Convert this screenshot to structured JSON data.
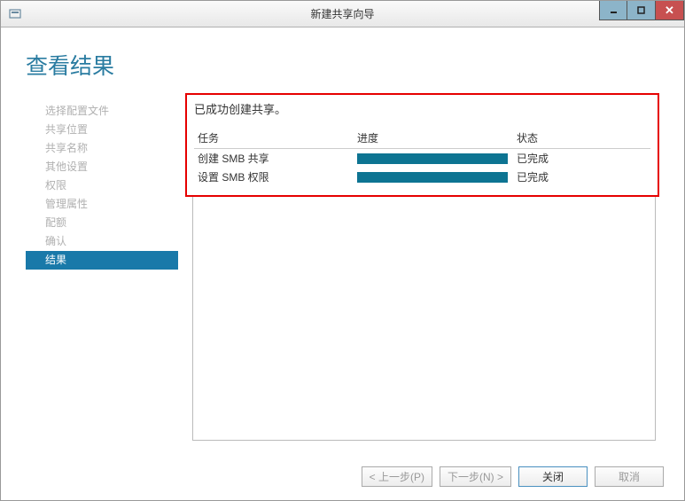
{
  "window": {
    "title": "新建共享向导"
  },
  "heading": "查看结果",
  "sidebar": {
    "items": [
      {
        "label": "选择配置文件",
        "active": false
      },
      {
        "label": "共享位置",
        "active": false
      },
      {
        "label": "共享名称",
        "active": false
      },
      {
        "label": "其他设置",
        "active": false
      },
      {
        "label": "权限",
        "active": false
      },
      {
        "label": "管理属性",
        "active": false
      },
      {
        "label": "配额",
        "active": false
      },
      {
        "label": "确认",
        "active": false
      },
      {
        "label": "结果",
        "active": true
      }
    ]
  },
  "main": {
    "result_message": "已成功创建共享。",
    "columns": {
      "task": "任务",
      "progress": "进度",
      "status": "状态"
    },
    "tasks": [
      {
        "name": "创建 SMB 共享",
        "progress": 100,
        "status": "已完成"
      },
      {
        "name": "设置 SMB 权限",
        "progress": 100,
        "status": "已完成"
      }
    ]
  },
  "footer": {
    "prev": "< 上一步(P)",
    "next": "下一步(N) >",
    "close": "关闭",
    "cancel": "取消"
  }
}
